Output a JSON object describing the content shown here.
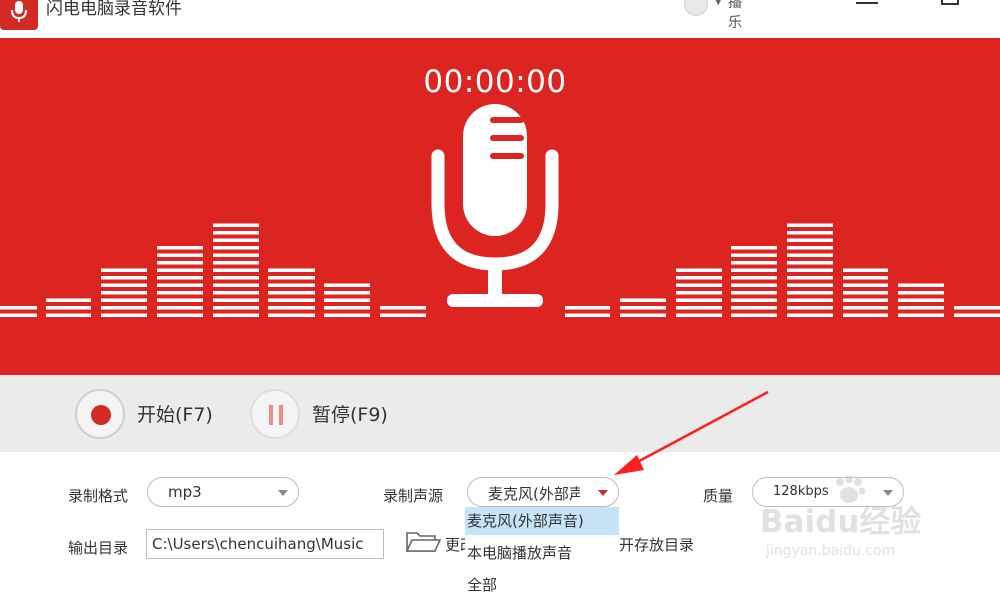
{
  "window": {
    "title": "闪电电脑录音软件",
    "user_name": "播乐"
  },
  "recorder": {
    "timer": "00:00:00"
  },
  "controls": {
    "start_label": "开始(F7)",
    "pause_label": "暂停(F9)"
  },
  "settings": {
    "format_label": "录制格式",
    "format_value": "mp3",
    "source_label": "录制声源",
    "source_value": "麦克风(外部声音)",
    "quality_label": "质量",
    "quality_value": "128kbps",
    "output_label": "输出目录",
    "output_path": "C:\\Users\\chencuihang\\Music",
    "change_label": "更改",
    "open_dir_label": "打开存放目录"
  },
  "source_options": [
    {
      "label": "麦克风(外部声音)",
      "selected": true
    },
    {
      "label": "本电脑播放声音",
      "selected": false
    },
    {
      "label": "全部",
      "selected": false
    }
  ],
  "watermark": {
    "brand": "Baidu经验",
    "url": "jingyan.baidu.com"
  },
  "colors": {
    "brand_red": "#dc2421",
    "control_gray": "#ebebeb",
    "selected_option": "#c7e3f6"
  },
  "icons": [
    "app-mic-logo-icon",
    "microphone-icon",
    "record-dot-icon",
    "pause-icon",
    "folder-icon",
    "dropdown-caret-icon"
  ]
}
